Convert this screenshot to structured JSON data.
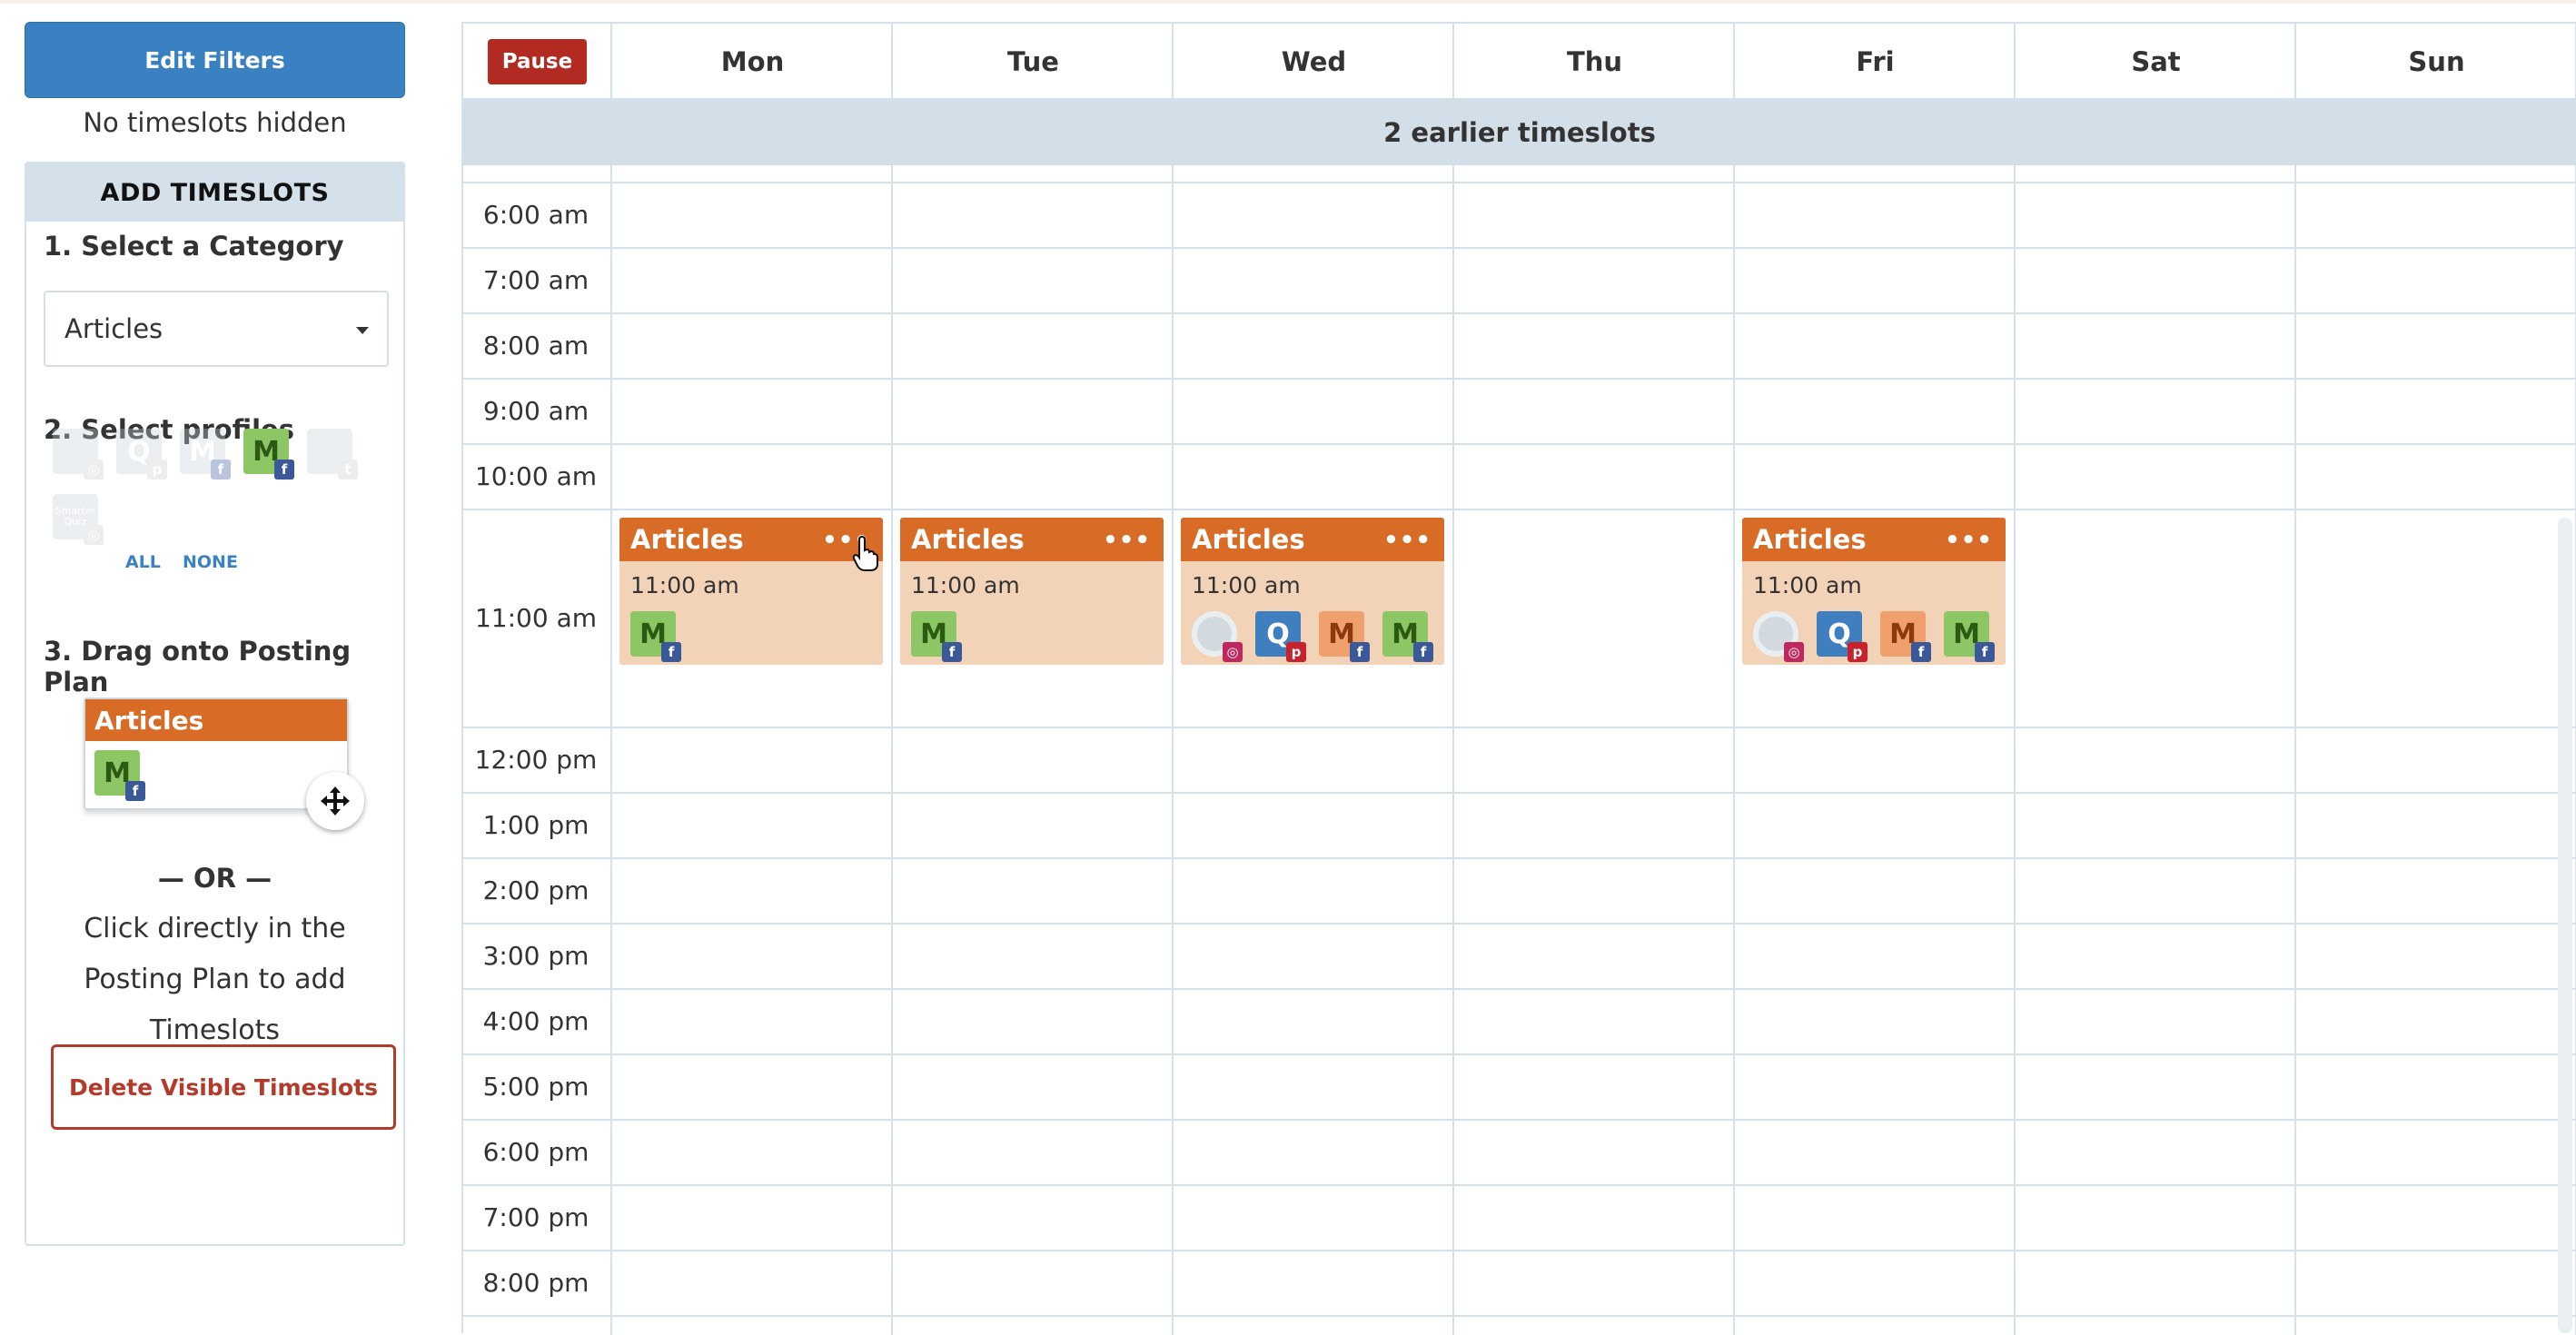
{
  "sidebar": {
    "edit_filters_label": "Edit Filters",
    "hidden_note": "No timeslots hidden",
    "panel_title": "ADD TIMESLOTS",
    "step1": "1. Select a Category",
    "category_value": "Articles",
    "step2": "2. Select profiles",
    "profiles": [
      {
        "id": "profile-1",
        "letter": "",
        "badge": "ig",
        "state": "inactive"
      },
      {
        "id": "profile-2",
        "letter": "Q",
        "badge": "p",
        "state": "inactive"
      },
      {
        "id": "profile-3",
        "letter": "M",
        "badge": "f",
        "state": "inactive"
      },
      {
        "id": "profile-4",
        "letter": "M",
        "badge": "f",
        "state": "active"
      },
      {
        "id": "profile-5",
        "letter": "",
        "badge": "t",
        "state": "inactive"
      },
      {
        "id": "profile-6",
        "letter": "Smarter Quiz",
        "badge": "ig",
        "state": "inactive"
      }
    ],
    "all_label": "ALL",
    "none_label": "NONE",
    "step3": "3. Drag onto Posting Plan",
    "drag_card_title": "Articles",
    "drag_card_letter": "M",
    "or_label": "— OR —",
    "click_note": "Click directly in the Posting Plan to add Timeslots",
    "delete_label": "Delete Visible Timeslots"
  },
  "calendar": {
    "pause_label": "Pause",
    "days": [
      "Mon",
      "Tue",
      "Wed",
      "Thu",
      "Fri",
      "Sat",
      "Sun"
    ],
    "earlier_label": "2 earlier timeslots",
    "times": [
      "6:00 am",
      "7:00 am",
      "8:00 am",
      "9:00 am",
      "10:00 am",
      "11:00 am",
      "12:00 pm",
      "1:00 pm",
      "2:00 pm",
      "3:00 pm",
      "4:00 pm",
      "5:00 pm",
      "6:00 pm",
      "7:00 pm",
      "8:00 pm"
    ],
    "timeslots": [
      {
        "day": "Mon",
        "title": "Articles",
        "dots": "•••",
        "time": "11:00 am",
        "profiles": [
          {
            "letter": "M",
            "badge": "f",
            "color": "green"
          }
        ]
      },
      {
        "day": "Tue",
        "title": "Articles",
        "dots": "•••",
        "time": "11:00 am",
        "profiles": [
          {
            "letter": "M",
            "badge": "f",
            "color": "green"
          }
        ]
      },
      {
        "day": "Wed",
        "title": "Articles",
        "dots": "•••",
        "time": "11:00 am",
        "profiles": [
          {
            "letter": "",
            "badge": "ig",
            "color": "grey"
          },
          {
            "letter": "Q",
            "badge": "p",
            "color": "blue"
          },
          {
            "letter": "M",
            "badge": "f",
            "color": "orange"
          },
          {
            "letter": "M",
            "badge": "f",
            "color": "green"
          }
        ]
      },
      {
        "day": "Fri",
        "title": "Articles",
        "dots": "•••",
        "time": "11:00 am",
        "profiles": [
          {
            "letter": "",
            "badge": "ig",
            "color": "grey"
          },
          {
            "letter": "Q",
            "badge": "p",
            "color": "blue"
          },
          {
            "letter": "M",
            "badge": "f",
            "color": "orange"
          },
          {
            "letter": "M",
            "badge": "f",
            "color": "green"
          }
        ]
      }
    ]
  },
  "colors": {
    "primary": "#3a81c1",
    "accent_orange": "#d86c27",
    "slot_bg": "#f2d3b8",
    "danger": "#b23b2b",
    "pause": "#b22a22",
    "grid": "#d5e1ea",
    "profile_green": "#8cc665",
    "profile_blue": "#3f7fbf",
    "profile_orange": "#f0a06d",
    "facebook": "#3b5998",
    "instagram": "#c1275f",
    "pinterest": "#c8232c"
  }
}
